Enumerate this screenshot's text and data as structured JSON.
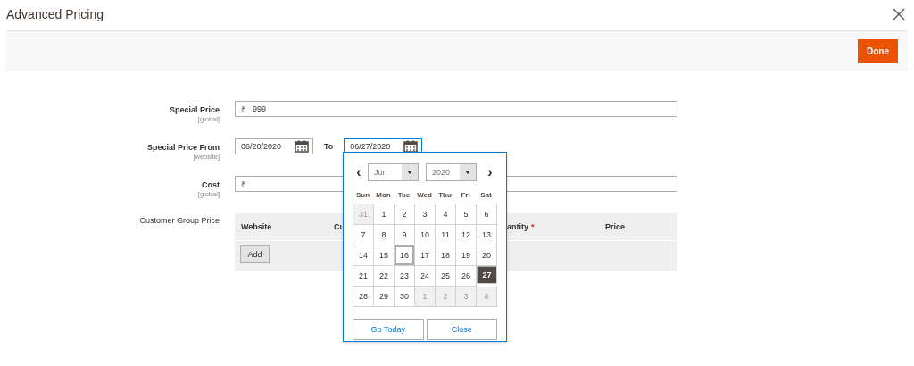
{
  "window": {
    "title": "Advanced Pricing"
  },
  "toolbar": {
    "done_button": "Done"
  },
  "fields": [
    {
      "label": "Special Price",
      "scope": "[global]",
      "kind": "price",
      "currency": "₹",
      "value": "999"
    },
    {
      "label": "Special Price From",
      "scope": "[website]",
      "kind": "daterange",
      "from": "06/20/2020",
      "to_label": "To",
      "to": "06/27/2020"
    },
    {
      "label": "Cost",
      "scope": "[global]",
      "kind": "price",
      "currency": "₹"
    }
  ],
  "customer_group_price": {
    "label": "Customer Group Price",
    "required_mark": "*",
    "columns": [
      {
        "text": "Website",
        "required": false
      },
      {
        "text": "Cu",
        "required": false
      },
      {
        "text": "antity",
        "required": true
      },
      {
        "text": "Price",
        "required": false
      }
    ],
    "add_button": "Add"
  },
  "datepicker": {
    "prev": "‹",
    "next": "›",
    "month": "Jun",
    "year": "2020",
    "weekdays": [
      "Sun",
      "Mon",
      "Tue",
      "Wed",
      "Thu",
      "Fri",
      "Sat"
    ],
    "weeks": [
      [
        {
          "label": "31",
          "other_month": true,
          "today": false,
          "selected": false
        },
        {
          "label": "1",
          "other_month": false,
          "today": false,
          "selected": false
        },
        {
          "label": "2",
          "other_month": false,
          "today": false,
          "selected": false
        },
        {
          "label": "3",
          "other_month": false,
          "today": false,
          "selected": false
        },
        {
          "label": "4",
          "other_month": false,
          "today": false,
          "selected": false
        },
        {
          "label": "5",
          "other_month": false,
          "today": false,
          "selected": false
        },
        {
          "label": "6",
          "other_month": false,
          "today": false,
          "selected": false
        }
      ],
      [
        {
          "label": "7",
          "other_month": false,
          "today": false,
          "selected": false
        },
        {
          "label": "8",
          "other_month": false,
          "today": false,
          "selected": false
        },
        {
          "label": "9",
          "other_month": false,
          "today": false,
          "selected": false
        },
        {
          "label": "10",
          "other_month": false,
          "today": false,
          "selected": false
        },
        {
          "label": "11",
          "other_month": false,
          "today": false,
          "selected": false
        },
        {
          "label": "12",
          "other_month": false,
          "today": false,
          "selected": false
        },
        {
          "label": "13",
          "other_month": false,
          "today": false,
          "selected": false
        }
      ],
      [
        {
          "label": "14",
          "other_month": false,
          "today": false,
          "selected": false
        },
        {
          "label": "15",
          "other_month": false,
          "today": false,
          "selected": false
        },
        {
          "label": "16",
          "other_month": false,
          "today": true,
          "selected": false
        },
        {
          "label": "17",
          "other_month": false,
          "today": false,
          "selected": false
        },
        {
          "label": "18",
          "other_month": false,
          "today": false,
          "selected": false
        },
        {
          "label": "19",
          "other_month": false,
          "today": false,
          "selected": false
        },
        {
          "label": "20",
          "other_month": false,
          "today": false,
          "selected": false
        }
      ],
      [
        {
          "label": "21",
          "other_month": false,
          "today": false,
          "selected": false
        },
        {
          "label": "22",
          "other_month": false,
          "today": false,
          "selected": false
        },
        {
          "label": "23",
          "other_month": false,
          "today": false,
          "selected": false
        },
        {
          "label": "24",
          "other_month": false,
          "today": false,
          "selected": false
        },
        {
          "label": "25",
          "other_month": false,
          "today": false,
          "selected": false
        },
        {
          "label": "26",
          "other_month": false,
          "today": false,
          "selected": false
        },
        {
          "label": "27",
          "other_month": false,
          "today": false,
          "selected": true
        }
      ],
      [
        {
          "label": "28",
          "other_month": false,
          "today": false,
          "selected": false
        },
        {
          "label": "29",
          "other_month": false,
          "today": false,
          "selected": false
        },
        {
          "label": "30",
          "other_month": false,
          "today": false,
          "selected": false
        },
        {
          "label": "1",
          "other_month": true,
          "today": false,
          "selected": false
        },
        {
          "label": "2",
          "other_month": true,
          "today": false,
          "selected": false
        },
        {
          "label": "3",
          "other_month": true,
          "today": false,
          "selected": false
        },
        {
          "label": "4",
          "other_month": true,
          "today": false,
          "selected": false
        }
      ]
    ],
    "go_today": "Go Today",
    "close": "Close"
  }
}
